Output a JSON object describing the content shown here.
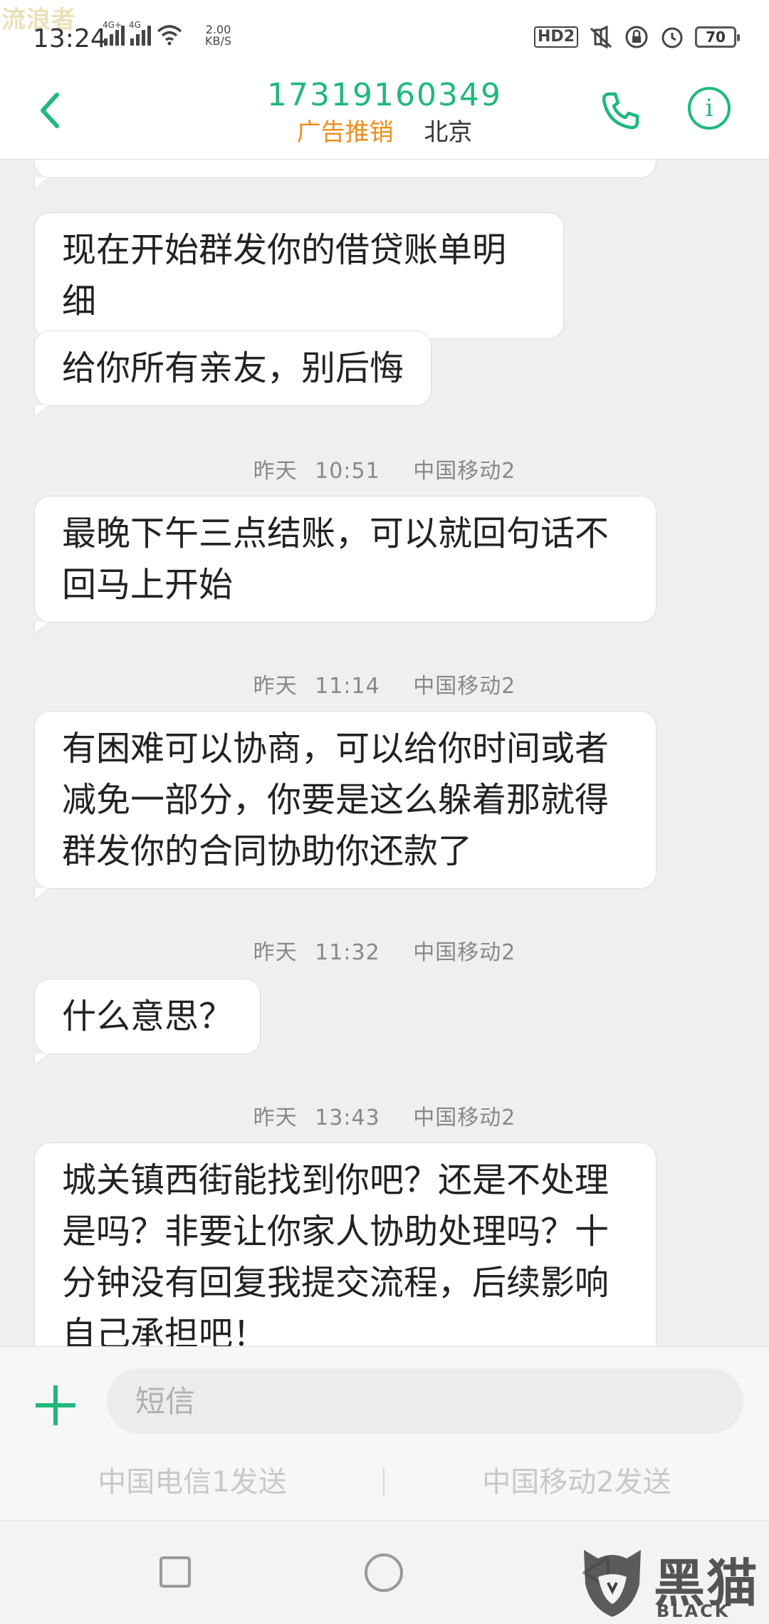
{
  "watermark": "流浪者",
  "status_bar": {
    "time": "13:24",
    "signal_1": "4G+",
    "signal_2": "4G",
    "net_speed": "2.00",
    "net_speed_unit": "KB/S",
    "hd_badge": "HD2",
    "battery": "70"
  },
  "header": {
    "number": "17319160349",
    "tag": "广告推销",
    "location": "北京"
  },
  "messages": [
    {
      "type": "bubble",
      "text": "现在开始群发你的借贷账单明细"
    },
    {
      "type": "bubble",
      "text": "给你所有亲友，别后悔"
    },
    {
      "type": "time",
      "date": "昨天",
      "time": "10:51",
      "carrier": "中国移动2"
    },
    {
      "type": "bubble",
      "text": "最晚下午三点结账，可以就回句话不回马上开始"
    },
    {
      "type": "time",
      "date": "昨天",
      "time": "11:14",
      "carrier": "中国移动2"
    },
    {
      "type": "bubble",
      "text": "有困难可以协商，可以给你时间或者减免一部分，你要是这么躲着那就得群发你的合同协助你还款了"
    },
    {
      "type": "time",
      "date": "昨天",
      "time": "11:32",
      "carrier": "中国移动2"
    },
    {
      "type": "bubble",
      "text": "什么意思？"
    },
    {
      "type": "time",
      "date": "昨天",
      "time": "13:43",
      "carrier": "中国移动2"
    },
    {
      "type": "bubble",
      "text": "城关镇西街能找到你吧？还是不处理是吗？非要让你家人协助处理吗？十分钟没有回复我提交流程，后续影响自己承担吧！"
    }
  ],
  "input": {
    "placeholder": "短信",
    "send_sim1": "中国电信1发送",
    "send_sim2": "中国移动2发送"
  },
  "brand": {
    "name_cn": "黑猫",
    "name_en": "BLACK CAT"
  },
  "colors": {
    "accent_green": "#1fb87c",
    "tag_orange": "#f08c1a",
    "bubble_bg": "#ffffff",
    "page_bg": "#efefef"
  },
  "icons": [
    "back-arrow-icon",
    "phone-icon",
    "info-icon",
    "plus-icon",
    "wifi-icon",
    "hd-icon",
    "mute-icon",
    "lock-icon",
    "alarm-icon",
    "battery-icon"
  ]
}
